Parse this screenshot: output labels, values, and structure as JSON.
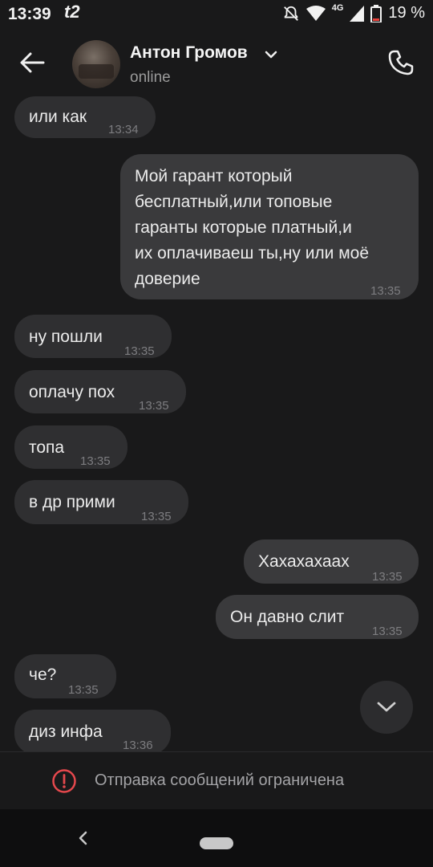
{
  "status_bar": {
    "time": "13:39",
    "carrier": "t2",
    "network": "4G",
    "battery_percent": "19 %"
  },
  "header": {
    "contact_name": "Антон Громов",
    "contact_status": "online"
  },
  "messages": [
    {
      "dir": "in",
      "text": "или как",
      "time": "13:34"
    },
    {
      "dir": "out",
      "text": "Мой гарант который бесплатный,или топовые гаранты которые платный,и их оплачиваеш ты,ну или моё доверие",
      "lines": [
        "Мой гарант который",
        "бесплатный,или топовые",
        "гаранты которые платный,и",
        "их оплачиваеш ты,ну или моё",
        "доверие"
      ],
      "time": "13:35"
    },
    {
      "dir": "in",
      "text": "ну пошли",
      "time": "13:35"
    },
    {
      "dir": "in",
      "text": "оплачу пох",
      "time": "13:35"
    },
    {
      "dir": "in",
      "text": "топа",
      "time": "13:35"
    },
    {
      "dir": "in",
      "text": "в др прими",
      "time": "13:35"
    },
    {
      "dir": "out",
      "text": "Хахахахаах",
      "time": "13:35"
    },
    {
      "dir": "out",
      "text": "Он давно слит",
      "time": "13:35"
    },
    {
      "dir": "in",
      "text": "че?",
      "time": "13:35"
    },
    {
      "dir": "in",
      "text": "диз инфа",
      "time": "13:36"
    }
  ],
  "restriction": {
    "text": "Отправка сообщений ограничена",
    "color": "#e5484d"
  },
  "icons": {
    "back": "arrow-left-icon",
    "call": "phone-icon",
    "scroll_down": "chevron-down-icon",
    "warning": "exclamation-circle-icon"
  }
}
